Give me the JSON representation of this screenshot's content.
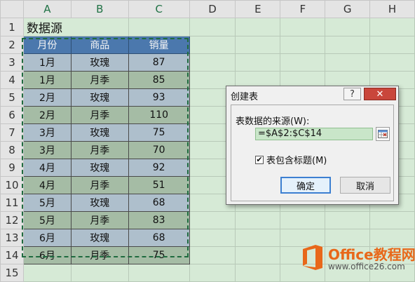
{
  "sheet": {
    "columns": [
      "A",
      "B",
      "C",
      "D",
      "E",
      "F",
      "G",
      "H"
    ],
    "title": "数据源",
    "headers": [
      "月份",
      "商品",
      "销量"
    ],
    "rows": [
      [
        "1月",
        "玫瑰",
        "87"
      ],
      [
        "1月",
        "月季",
        "85"
      ],
      [
        "2月",
        "玫瑰",
        "93"
      ],
      [
        "2月",
        "月季",
        "110"
      ],
      [
        "3月",
        "玫瑰",
        "75"
      ],
      [
        "3月",
        "月季",
        "70"
      ],
      [
        "4月",
        "玫瑰",
        "92"
      ],
      [
        "4月",
        "月季",
        "51"
      ],
      [
        "5月",
        "玫瑰",
        "68"
      ],
      [
        "5月",
        "月季",
        "83"
      ],
      [
        "6月",
        "玫瑰",
        "68"
      ],
      [
        "6月",
        "月季",
        "75"
      ]
    ],
    "row_numbers": [
      "1",
      "2",
      "3",
      "4",
      "5",
      "6",
      "7",
      "8",
      "9",
      "10",
      "11",
      "12",
      "13",
      "14",
      "15"
    ]
  },
  "dialog": {
    "title": "创建表",
    "help_label": "?",
    "close_label": "✕",
    "source_label": "表数据的来源(W):",
    "range_value": "=$A$2:$C$14",
    "has_headers_label": "表包含标题(M)",
    "has_headers_checked": true,
    "ok_label": "确定",
    "cancel_label": "取消"
  },
  "watermark": {
    "name": "Office教程网",
    "url": "www.office26.com"
  },
  "colors": {
    "sheet_bg": "#d6ead6",
    "header_fill": "#4b78ad",
    "band_1": "#aebfcc",
    "band_2": "#a5bca5",
    "marquee": "#1f6b3f",
    "brand": "#e8681a"
  }
}
